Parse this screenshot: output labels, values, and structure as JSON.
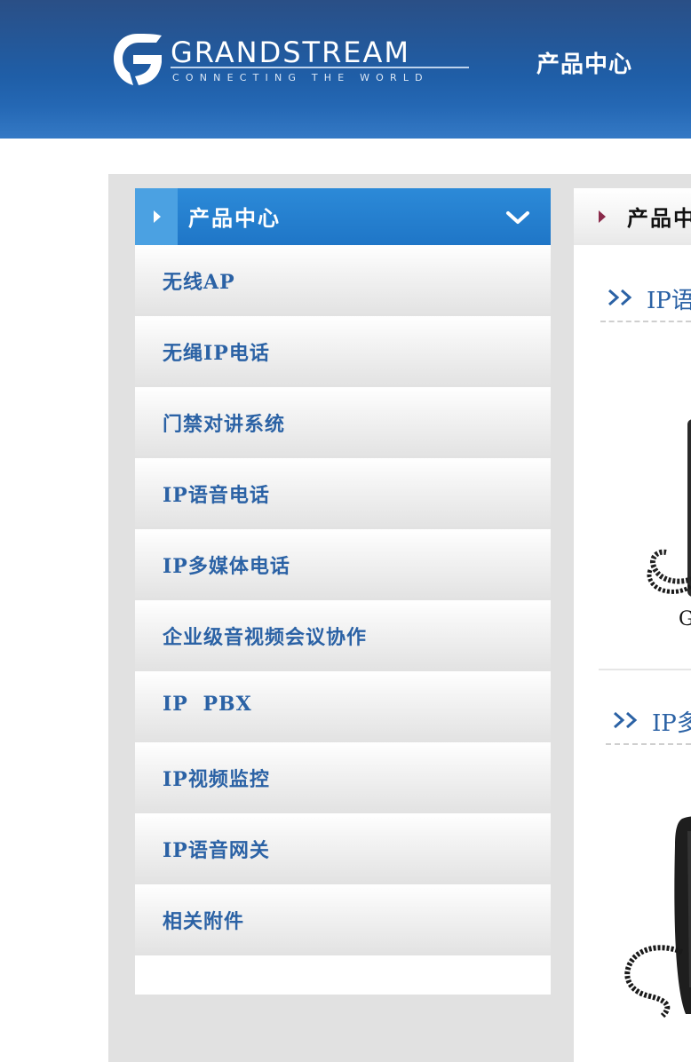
{
  "header": {
    "brand": "GRANDSTREAM",
    "tagline": "CONNECTING THE WORLD",
    "title": "产品中心"
  },
  "sidebar": {
    "title": "产品中心",
    "items": [
      {
        "label": "无线AP"
      },
      {
        "label": "无绳IP电话"
      },
      {
        "label": "门禁对讲系统"
      },
      {
        "label": "IP语音电话"
      },
      {
        "label": "IP多媒体电话"
      },
      {
        "label": "企业级音视频会议协作"
      },
      {
        "label": "IP PBX"
      },
      {
        "label": "IP视频监控"
      },
      {
        "label": "IP语音网关"
      },
      {
        "label": "相关附件"
      }
    ]
  },
  "content": {
    "title": "产品中",
    "sections": [
      {
        "title": "IP语",
        "caption": "G"
      },
      {
        "title": "IP多"
      }
    ]
  },
  "colors": {
    "header_bg": "#1f5ea7",
    "sidebar_head": "#1f76c7",
    "link_blue": "#2b62a5",
    "panel_gray": "#e1e1e1"
  }
}
